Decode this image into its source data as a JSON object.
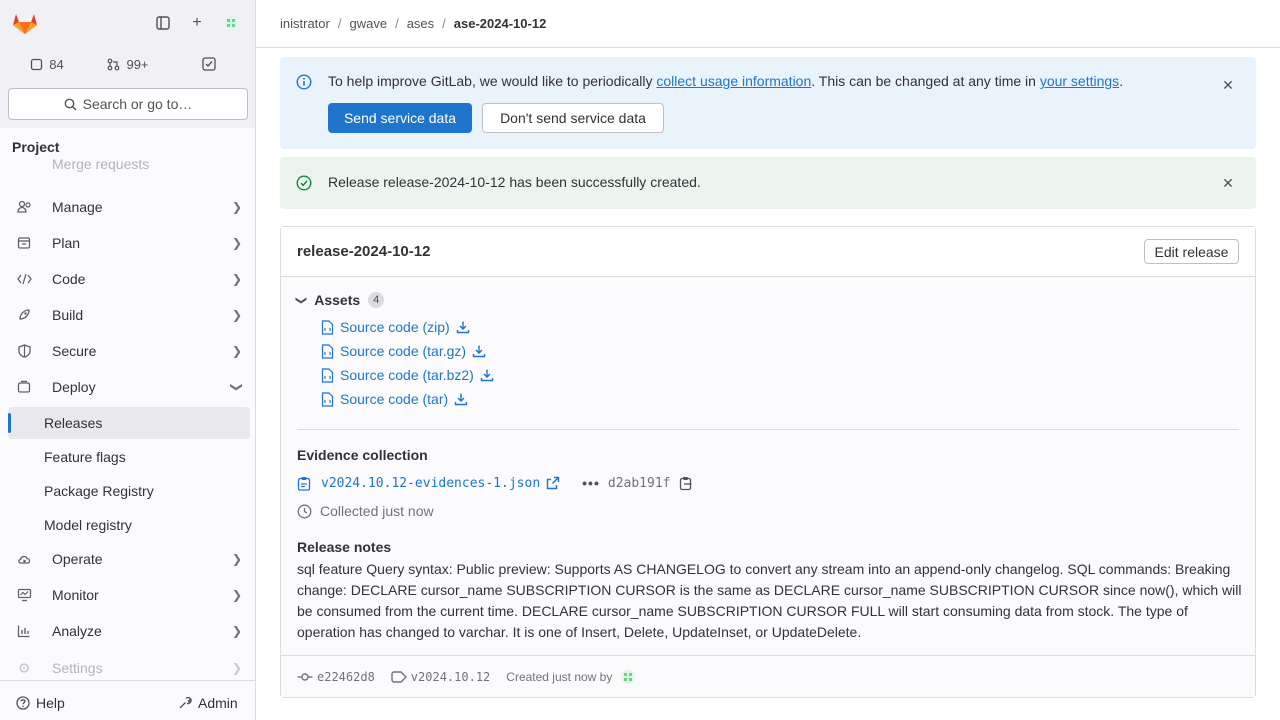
{
  "sidebar": {
    "todos_count": "84",
    "mr_count": "99+",
    "search_label": "Search or go to…",
    "section_title": "Project",
    "faded_item_top": "Merge requests",
    "items": [
      {
        "label": "Manage"
      },
      {
        "label": "Plan"
      },
      {
        "label": "Code"
      },
      {
        "label": "Build"
      },
      {
        "label": "Secure"
      },
      {
        "label": "Deploy"
      },
      {
        "label": "Releases"
      },
      {
        "label": "Feature flags"
      },
      {
        "label": "Package Registry"
      },
      {
        "label": "Model registry"
      },
      {
        "label": "Operate"
      },
      {
        "label": "Monitor"
      },
      {
        "label": "Analyze"
      },
      {
        "label": "Settings"
      }
    ],
    "help_label": "Help",
    "admin_label": "Admin"
  },
  "breadcrumb": {
    "items": [
      "inistrator",
      "gwave",
      "ases"
    ],
    "current": "ase-2024-10-12"
  },
  "info_alert": {
    "text_before": "To help improve GitLab, we would like to periodically ",
    "link1": "collect usage information",
    "text_middle": ". This can be changed at any time in ",
    "link2": "your settings",
    "text_after": ".",
    "primary_button": "Send service data",
    "secondary_button": "Don't send service data"
  },
  "success_alert": {
    "text": "Release release-2024-10-12 has been successfully created."
  },
  "release": {
    "title": "release-2024-10-12",
    "edit_button": "Edit release",
    "assets_label": "Assets",
    "assets_count": "4",
    "assets": [
      {
        "label": "Source code (zip)"
      },
      {
        "label": "Source code (tar.gz)"
      },
      {
        "label": "Source code (tar.bz2)"
      },
      {
        "label": "Source code (tar)"
      }
    ],
    "evidence_heading": "Evidence collection",
    "evidence_file": "v2024.10.12-evidences-1.json",
    "evidence_sha": "d2ab191f",
    "collected_text": "Collected just now",
    "notes_heading": "Release notes",
    "notes_text": "sql feature Query syntax: Public preview: Supports AS CHANGELOG to convert any stream into an append-only changelog. SQL commands: Breaking change: DECLARE cursor_name SUBSCRIPTION CURSOR is the same as DECLARE cursor_name SUBSCRIPTION CURSOR since now(), which will be consumed from the current time. DECLARE cursor_name SUBSCRIPTION CURSOR FULL will start consuming data from stock. The type of operation has changed to varchar. It is one of Insert, Delete, UpdateInset, or UpdateDelete.",
    "footer_commit": "e22462d8",
    "footer_tag": "v2024.10.12",
    "footer_created": "Created just now by"
  },
  "colors": {
    "accent": "#1f75cb",
    "info_bg": "#e9f3fc",
    "success_bg": "#ecf4ee",
    "success_icon": "#108548"
  }
}
